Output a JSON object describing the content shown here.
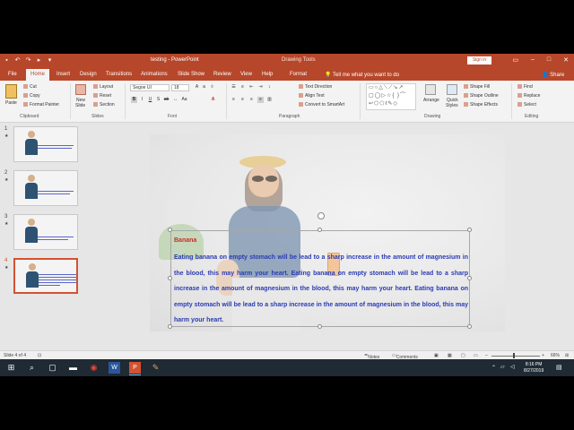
{
  "window": {
    "doc_title": "testing - PowerPoint",
    "tool_title": "Drawing Tools",
    "signin_label": "Sign in"
  },
  "tabs": [
    {
      "label": "File"
    },
    {
      "label": "Home"
    },
    {
      "label": "Insert"
    },
    {
      "label": "Design"
    },
    {
      "label": "Transitions"
    },
    {
      "label": "Animations"
    },
    {
      "label": "Slide Show"
    },
    {
      "label": "Review"
    },
    {
      "label": "View"
    },
    {
      "label": "Help"
    },
    {
      "label": "Format"
    }
  ],
  "active_tab": "Home",
  "tell_me": "Tell me what you want to do",
  "share_label": "Share",
  "ribbon": {
    "clipboard": {
      "paste": "Paste",
      "cut": "Cut",
      "copy": "Copy",
      "format_painter": "Format Painter",
      "label": "Clipboard"
    },
    "slides": {
      "new_slide": "New",
      "new_slide2": "Slide",
      "layout": "Layout",
      "reset": "Reset",
      "section": "Section",
      "label": "Slides"
    },
    "font": {
      "family": "Segoe UI",
      "size": "18",
      "label": "Font"
    },
    "paragraph": {
      "text_direction": "Text Direction",
      "align_text": "Align Text",
      "convert_smartart": "Convert to SmartArt",
      "label": "Paragraph"
    },
    "drawing": {
      "arrange": "Arrange",
      "quick_styles": "Quick",
      "quick_styles2": "Styles",
      "shape_fill": "Shape Fill",
      "shape_outline": "Shape Outline",
      "shape_effects": "Shape Effects",
      "label": "Drawing"
    },
    "editing": {
      "find": "Find",
      "replace": "Replace",
      "select": "Select",
      "label": "Editing"
    }
  },
  "thumbnails": [
    {
      "number": "1",
      "star": "★"
    },
    {
      "number": "2",
      "star": "★"
    },
    {
      "number": "3",
      "star": "★"
    },
    {
      "number": "4",
      "star": "★"
    }
  ],
  "selected_slide": 4,
  "slide": {
    "heading": "Banana",
    "body": "Eating banana on empty stomach will be lead to a sharp increase in the amount of magnesium in the blood, this may harm your heart. Eating banana on empty stomach will be lead to a sharp increase in the amount of magnesium in the blood, this may harm your heart. Eating banana on empty stomach will be lead to a sharp increase in the amount of magnesium in the blood, this may harm your heart."
  },
  "status": {
    "slide_count": "Slide 4 of 4",
    "notes": "Notes",
    "comments": "Comments",
    "zoom": "66%"
  },
  "clock": {
    "time": "8:16 PM",
    "date": "8/27/2019"
  },
  "colors": {
    "accent": "#b7472a",
    "heading": "#c62d2d",
    "body_text": "#2a3bb4",
    "selection": "#d35230"
  }
}
